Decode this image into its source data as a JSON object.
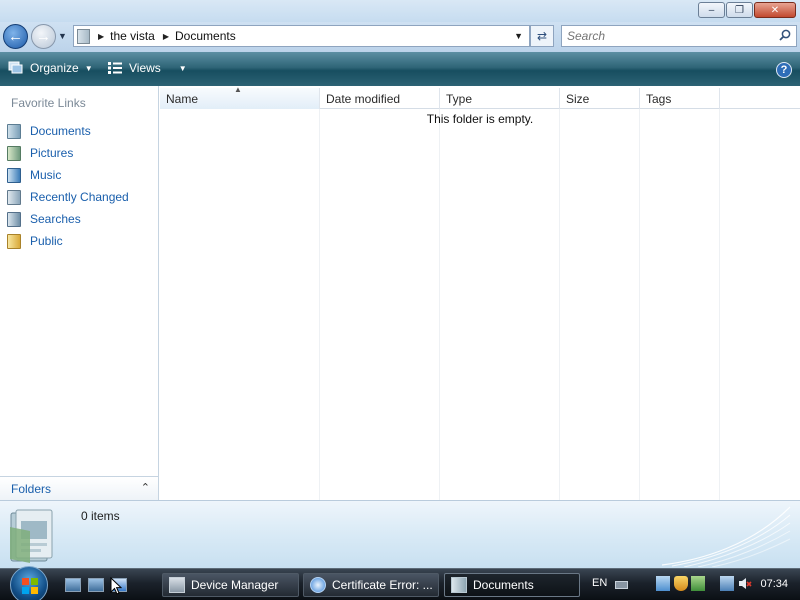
{
  "window": {
    "controls": {
      "minimize": "–",
      "maximize": "❐",
      "close": "✕"
    }
  },
  "navigation": {
    "back_icon": "back-arrow-icon",
    "forward_icon": "forward-arrow-icon",
    "breadcrumb": [
      "the vista",
      "Documents"
    ]
  },
  "search": {
    "placeholder": "Search"
  },
  "toolbar": {
    "organize_label": "Organize",
    "views_label": "Views",
    "help_label": "?"
  },
  "sidebar": {
    "favorite_links_title": "Favorite Links",
    "items": [
      {
        "label": "Documents",
        "icon": "documents-icon"
      },
      {
        "label": "Pictures",
        "icon": "pictures-icon"
      },
      {
        "label": "Music",
        "icon": "music-icon"
      },
      {
        "label": "Recently Changed",
        "icon": "recently-changed-icon"
      },
      {
        "label": "Searches",
        "icon": "searches-icon"
      },
      {
        "label": "Public",
        "icon": "public-folder-icon"
      }
    ],
    "folders_label": "Folders"
  },
  "file_list": {
    "columns": [
      "Name",
      "Date modified",
      "Type",
      "Size",
      "Tags"
    ],
    "empty_message": "This folder is empty."
  },
  "details_pane": {
    "item_count": "0 items"
  },
  "taskbar": {
    "tasks": [
      {
        "label": "Device Manager",
        "active": false
      },
      {
        "label": "Certificate Error: ...",
        "active": false
      },
      {
        "label": "Documents",
        "active": true
      }
    ],
    "language": "EN",
    "clock": "07:34"
  },
  "colors": {
    "link_blue": "#1a5fac",
    "command_bar": "#2f6577",
    "taskbar": "#1b222b"
  }
}
